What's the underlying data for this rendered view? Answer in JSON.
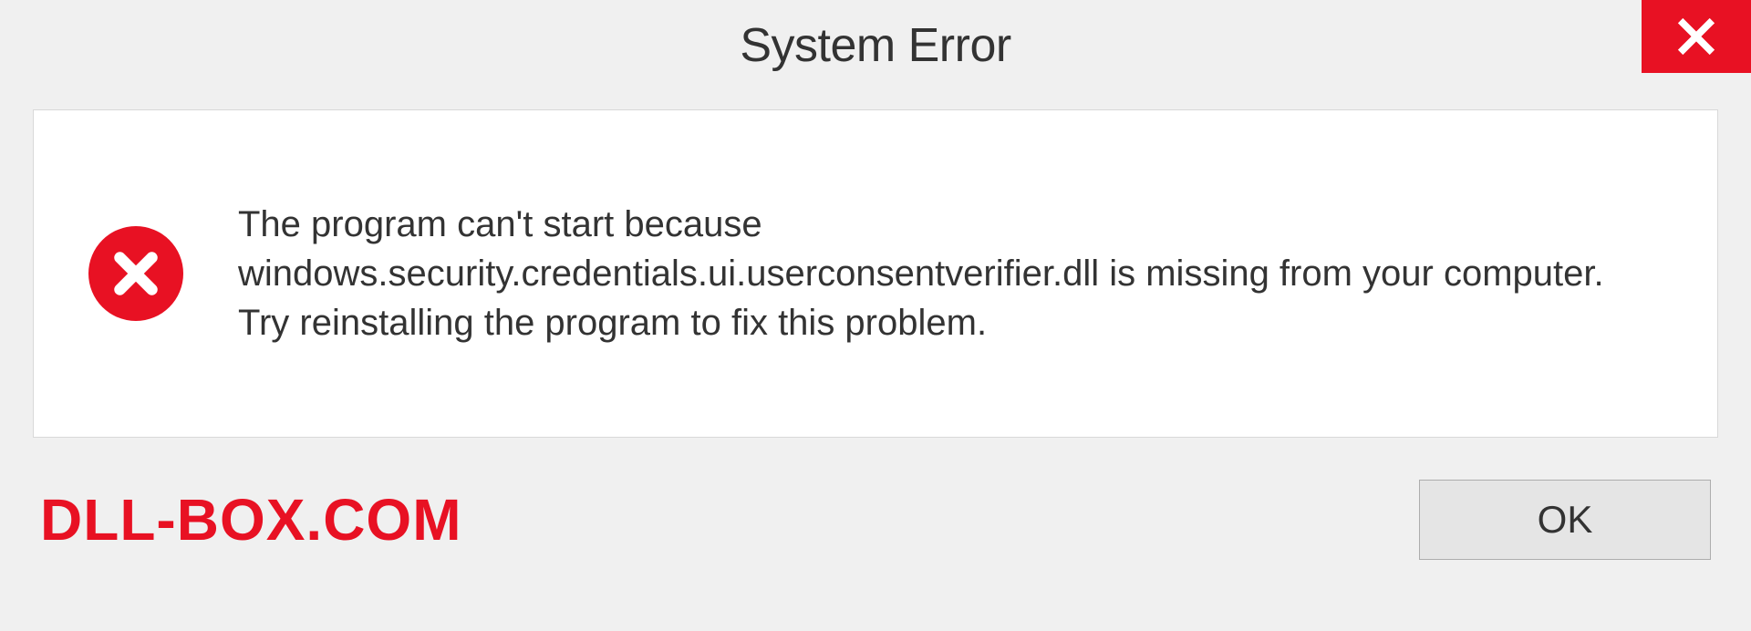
{
  "titlebar": {
    "title": "System Error",
    "close_icon": "close-icon"
  },
  "body": {
    "error_icon": "error-circle-x-icon",
    "message": "The program can't start because windows.security.credentials.ui.userconsentverifier.dll is missing from your computer. Try reinstalling the program to fix this problem."
  },
  "footer": {
    "watermark": "DLL-BOX.COM",
    "ok_label": "OK"
  },
  "colors": {
    "accent_red": "#e81123",
    "panel_bg": "#ffffff",
    "window_bg": "#f0f0f0",
    "button_bg": "#e5e5e5",
    "text": "#333333"
  }
}
